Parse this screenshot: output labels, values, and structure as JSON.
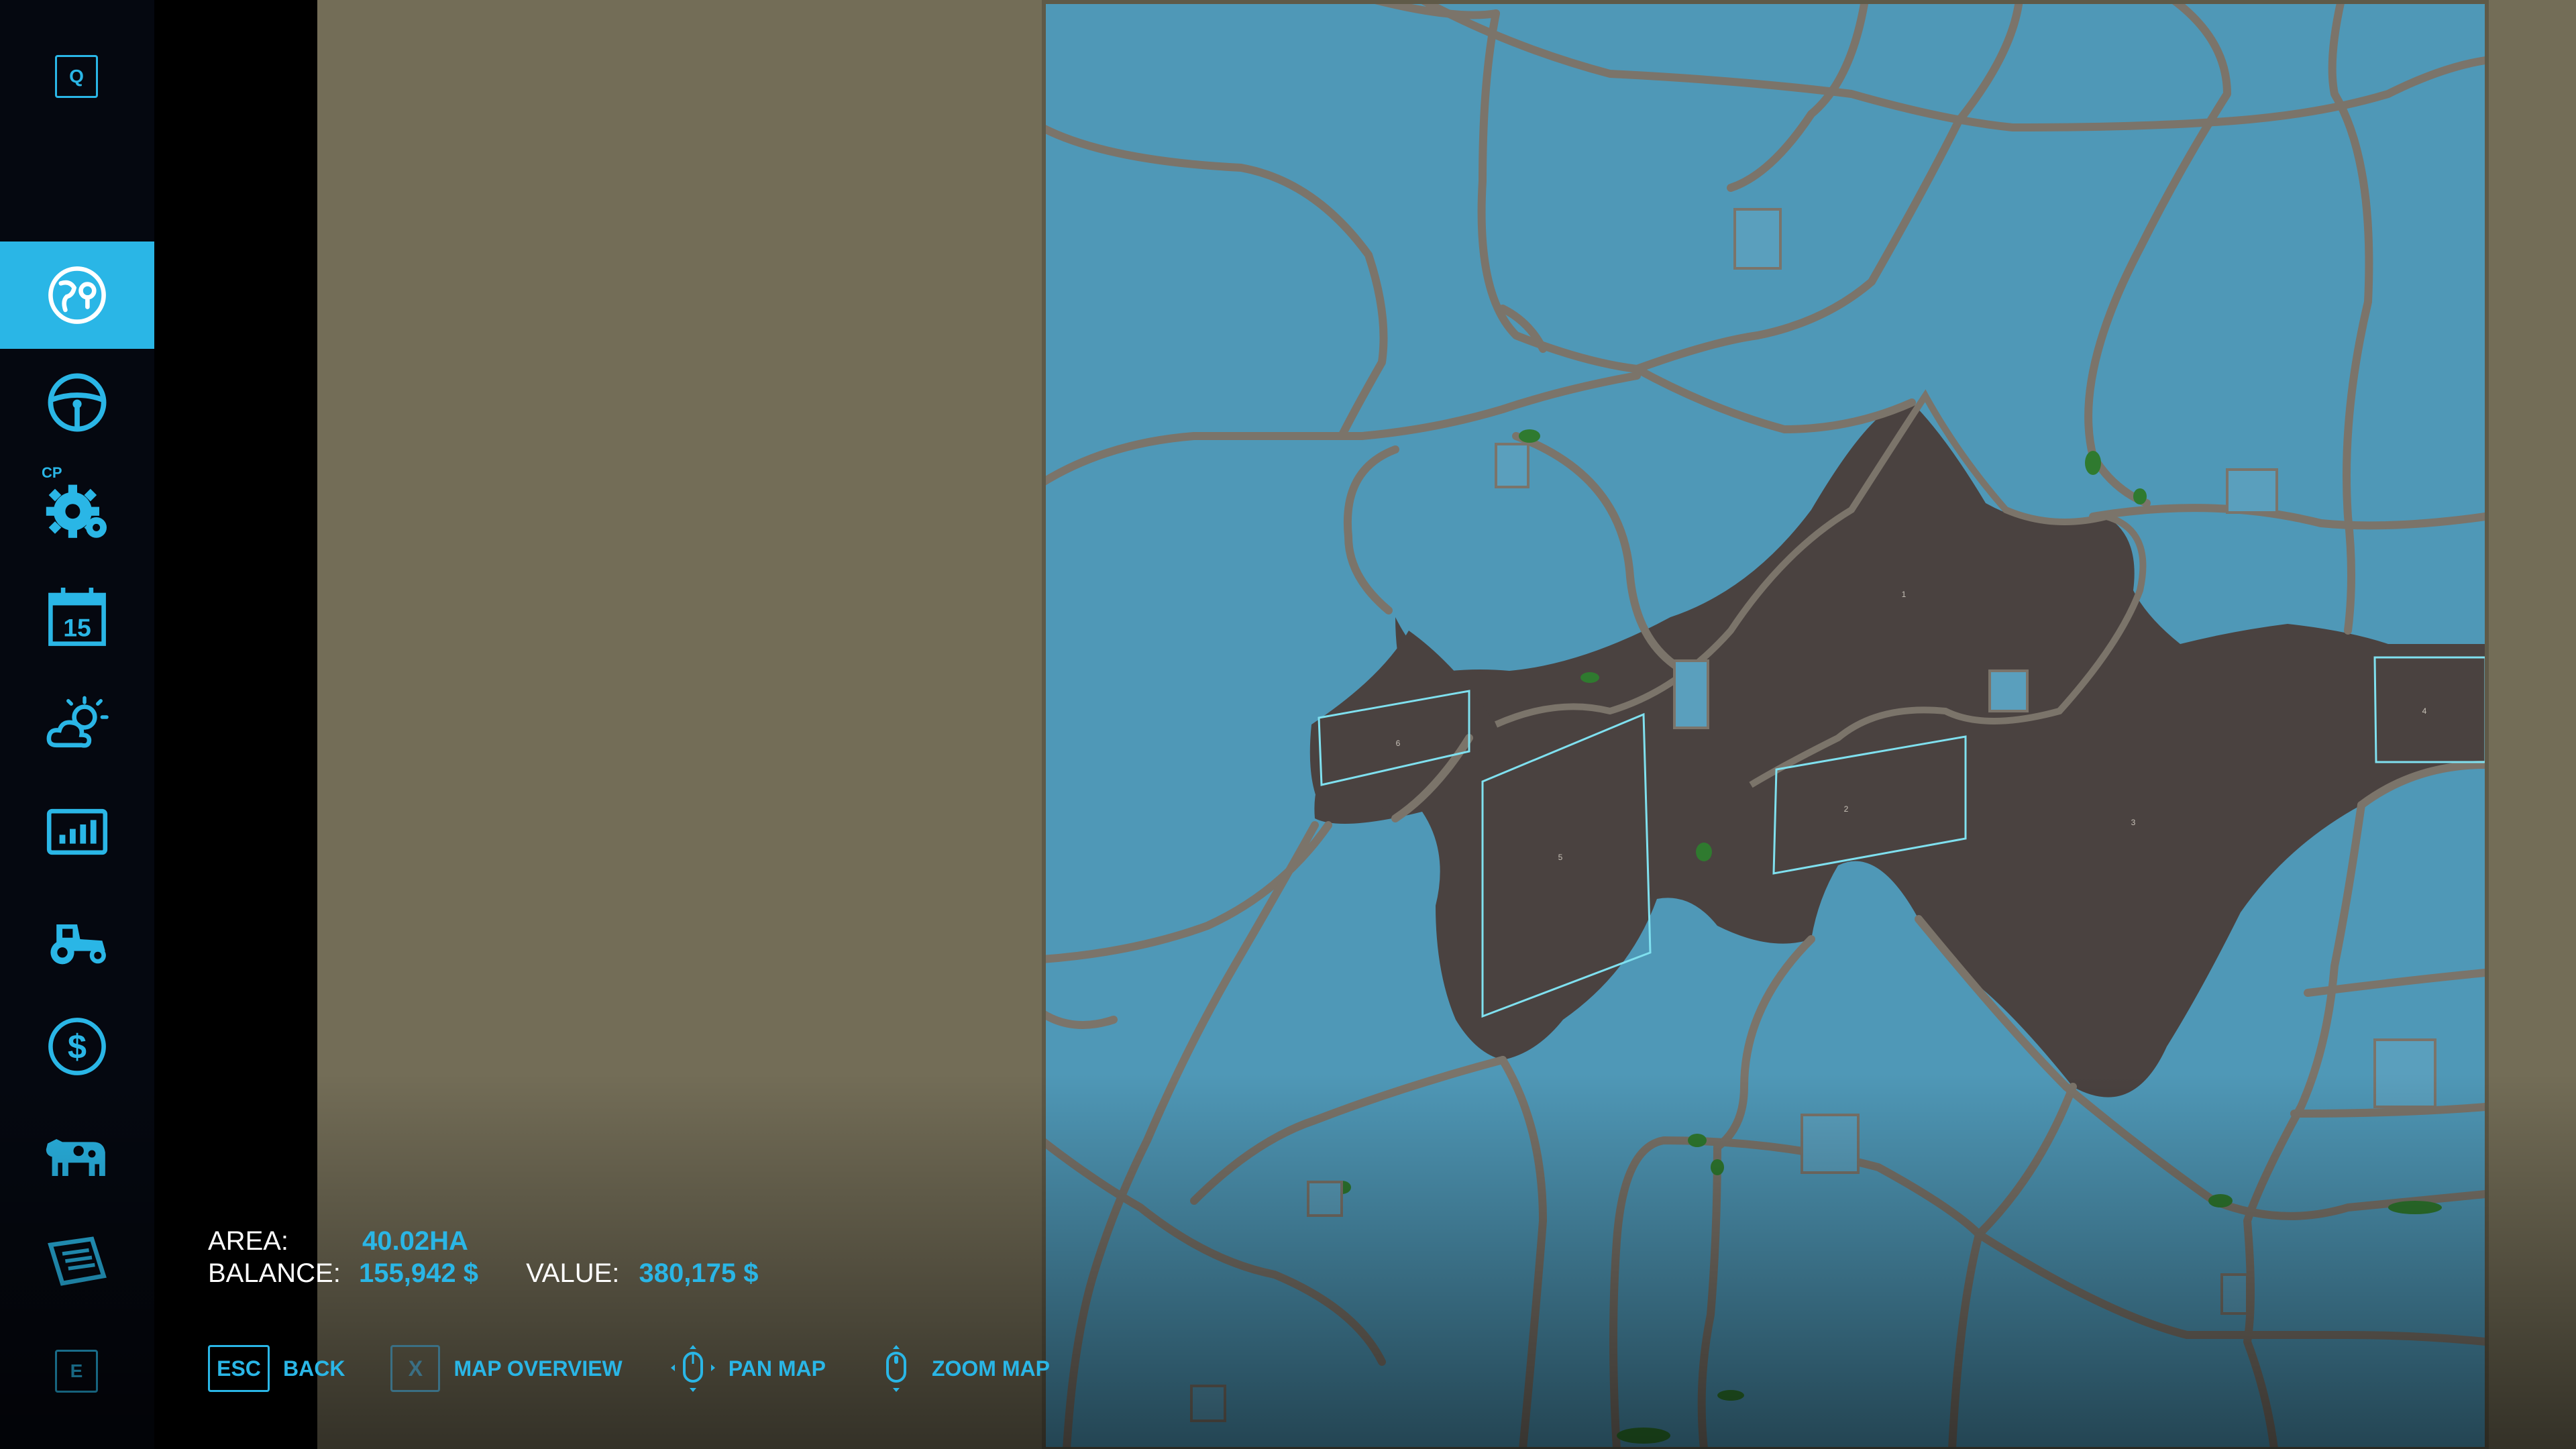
{
  "sidebar": {
    "top_key": "Q",
    "bottom_key": "E",
    "cp_label": "CP",
    "items": [
      {
        "name": "map",
        "icon": "globe-map-icon",
        "active": true
      },
      {
        "name": "vehicles",
        "icon": "steering-wheel-icon",
        "active": false
      },
      {
        "name": "courseplay-settings",
        "icon": "gear-icon",
        "active": false
      },
      {
        "name": "calendar",
        "icon": "calendar-icon",
        "active": false
      },
      {
        "name": "weather",
        "icon": "weather-icon",
        "active": false
      },
      {
        "name": "statistics",
        "icon": "chart-icon",
        "active": false
      },
      {
        "name": "garage",
        "icon": "tractor-icon",
        "active": false
      },
      {
        "name": "finances",
        "icon": "dollar-icon",
        "active": false
      },
      {
        "name": "animals",
        "icon": "cow-icon",
        "active": false
      },
      {
        "name": "help",
        "icon": "book-icon",
        "active": false
      }
    ]
  },
  "info": {
    "area_label": "AREA:",
    "area_value": "40.02HA",
    "balance_label": "BALANCE:",
    "balance_value": "155,942 $",
    "value_label": "VALUE:",
    "value_value": "380,175 $"
  },
  "controls": {
    "back_key": "ESC",
    "back_label": "BACK",
    "overview_key": "X",
    "overview_label": "MAP OVERVIEW",
    "pan_label": "PAN MAP",
    "zoom_label": "ZOOM MAP"
  },
  "map": {
    "fields": [
      "1",
      "2",
      "3",
      "4",
      "5",
      "6"
    ],
    "colors": {
      "water": "#4f98b7",
      "land": "#4a4240",
      "road": "#7b746a",
      "field_outline": "#7fe0ef",
      "tree": "#2f7a2f",
      "accent": "#2ab6e6"
    }
  }
}
